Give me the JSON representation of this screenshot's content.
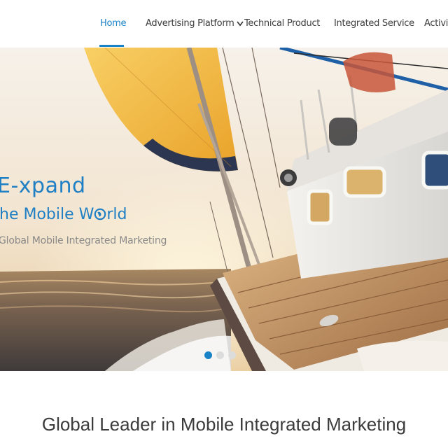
{
  "nav": {
    "items": [
      {
        "label": "Home",
        "active": true
      },
      {
        "label": "Advertising Platform",
        "has_dropdown": true
      },
      {
        "label": "Technical Product"
      },
      {
        "label": "Integrated Service"
      },
      {
        "label": "Activiti"
      }
    ]
  },
  "hero": {
    "headline": "E-xpand",
    "headline2_pre": "he Mobile W",
    "headline2_post": "rld",
    "subtitle": "Global Mobile Integrated Marketing",
    "slides": 3,
    "active_slide": 1
  },
  "section": {
    "title": "Global Leader in Mobile Integrated Marketing"
  },
  "colors": {
    "accent": "#1a83c7",
    "sail": "#f3b633",
    "sea": "#6b5a4a"
  }
}
